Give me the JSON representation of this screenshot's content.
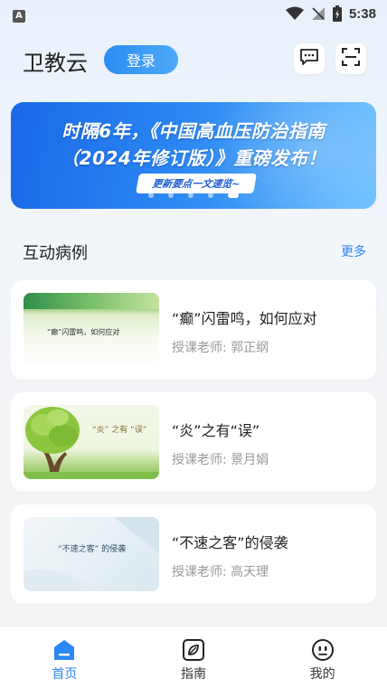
{
  "status_bar": {
    "time": "5:38"
  },
  "header": {
    "app_title": "卫教云",
    "login_label": "登录"
  },
  "banner": {
    "line1": "时隔6年，《中国高血压防治指南",
    "line2": "（2024年修订版）》重磅发布！",
    "pill": "更新要点一文速览~",
    "slide_count": 5,
    "active_slide": 5
  },
  "section": {
    "title": "互动病例",
    "more_label": "更多"
  },
  "cases": [
    {
      "title": "“癫”闪雷鸣，如何应对",
      "teacher": "授课老师: 郭正纲",
      "thumb_caption": "“癫”闪雷鸣，如何应对"
    },
    {
      "title": "“炎”之有“误”",
      "teacher": "授课老师: 景月娟",
      "thumb_caption": "“炎” 之有 “误”"
    },
    {
      "title": "“不速之客”的侵袭",
      "teacher": "授课老师: 高天理",
      "thumb_caption": "“不速之客” 的侵袭"
    }
  ],
  "tabs": [
    {
      "label": "首页",
      "icon": "home-icon",
      "active": true
    },
    {
      "label": "指南",
      "icon": "guide-icon",
      "active": false
    },
    {
      "label": "我的",
      "icon": "profile-icon",
      "active": false
    }
  ],
  "colors": {
    "accent": "#2c86f5",
    "muted_text": "#999999"
  }
}
